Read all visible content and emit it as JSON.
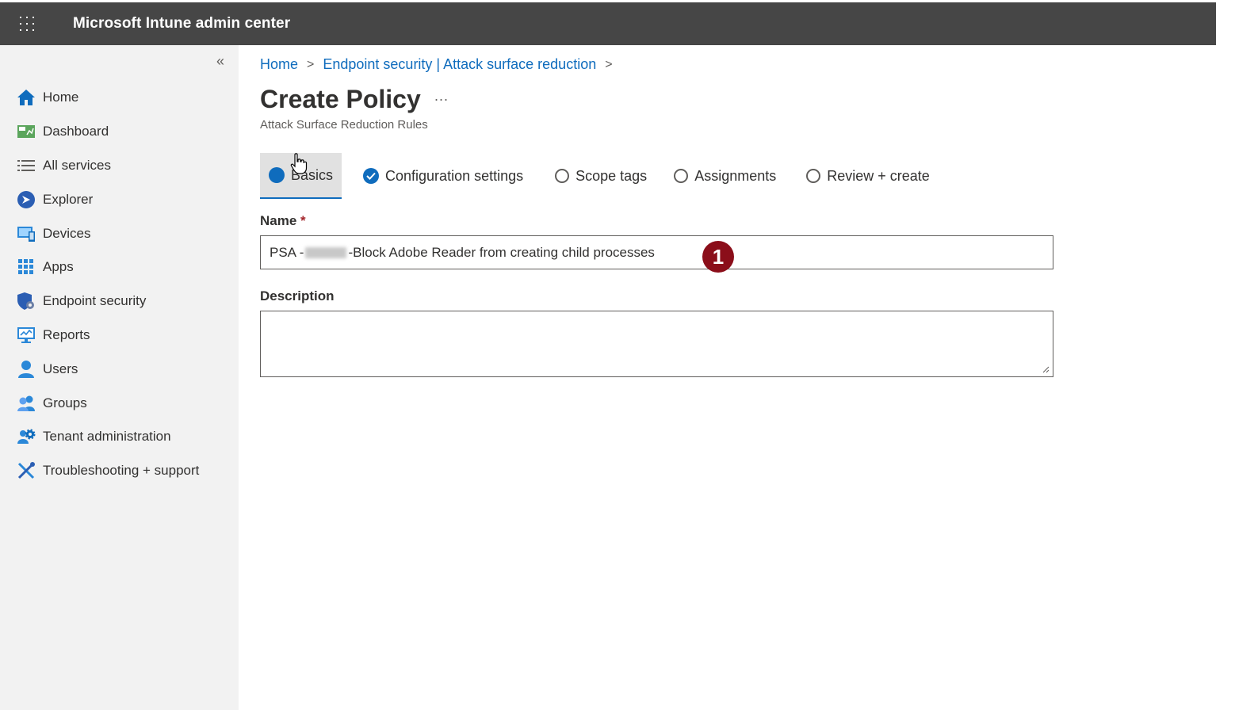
{
  "header": {
    "title": "Microsoft Intune admin center"
  },
  "sidebar": {
    "collapse_label": "«",
    "items": [
      {
        "label": "Home",
        "icon": "home-icon"
      },
      {
        "label": "Dashboard",
        "icon": "dashboard-icon"
      },
      {
        "label": "All services",
        "icon": "list-icon"
      },
      {
        "label": "Explorer",
        "icon": "explorer-icon"
      },
      {
        "label": "Devices",
        "icon": "devices-icon"
      },
      {
        "label": "Apps",
        "icon": "apps-icon"
      },
      {
        "label": "Endpoint security",
        "icon": "shield-icon"
      },
      {
        "label": "Reports",
        "icon": "reports-icon"
      },
      {
        "label": "Users",
        "icon": "user-icon"
      },
      {
        "label": "Groups",
        "icon": "groups-icon"
      },
      {
        "label": "Tenant administration",
        "icon": "tenant-gear-icon"
      },
      {
        "label": "Troubleshooting + support",
        "icon": "tools-icon"
      }
    ]
  },
  "breadcrumb": {
    "home": "Home",
    "section": "Endpoint security | Attack surface reduction"
  },
  "page": {
    "title": "Create Policy",
    "more": "...",
    "subtitle": "Attack Surface Reduction Rules"
  },
  "steps": [
    {
      "label": "Basics",
      "state": "current"
    },
    {
      "label": "Configuration settings",
      "state": "complete"
    },
    {
      "label": "Scope tags",
      "state": "pending"
    },
    {
      "label": "Assignments",
      "state": "pending"
    },
    {
      "label": "Review + create",
      "state": "pending"
    }
  ],
  "form": {
    "name_label": "Name",
    "required_mark": "*",
    "name_prefix": "PSA -",
    "name_suffix": "-Block Adobe Reader from creating child processes",
    "description_label": "Description",
    "description_value": ""
  },
  "annotation": {
    "badge": "1"
  },
  "colors": {
    "accent": "#0f6cbd",
    "topbar": "#464646",
    "sidebar": "#f2f2f2",
    "badge": "#8b0e1a"
  }
}
